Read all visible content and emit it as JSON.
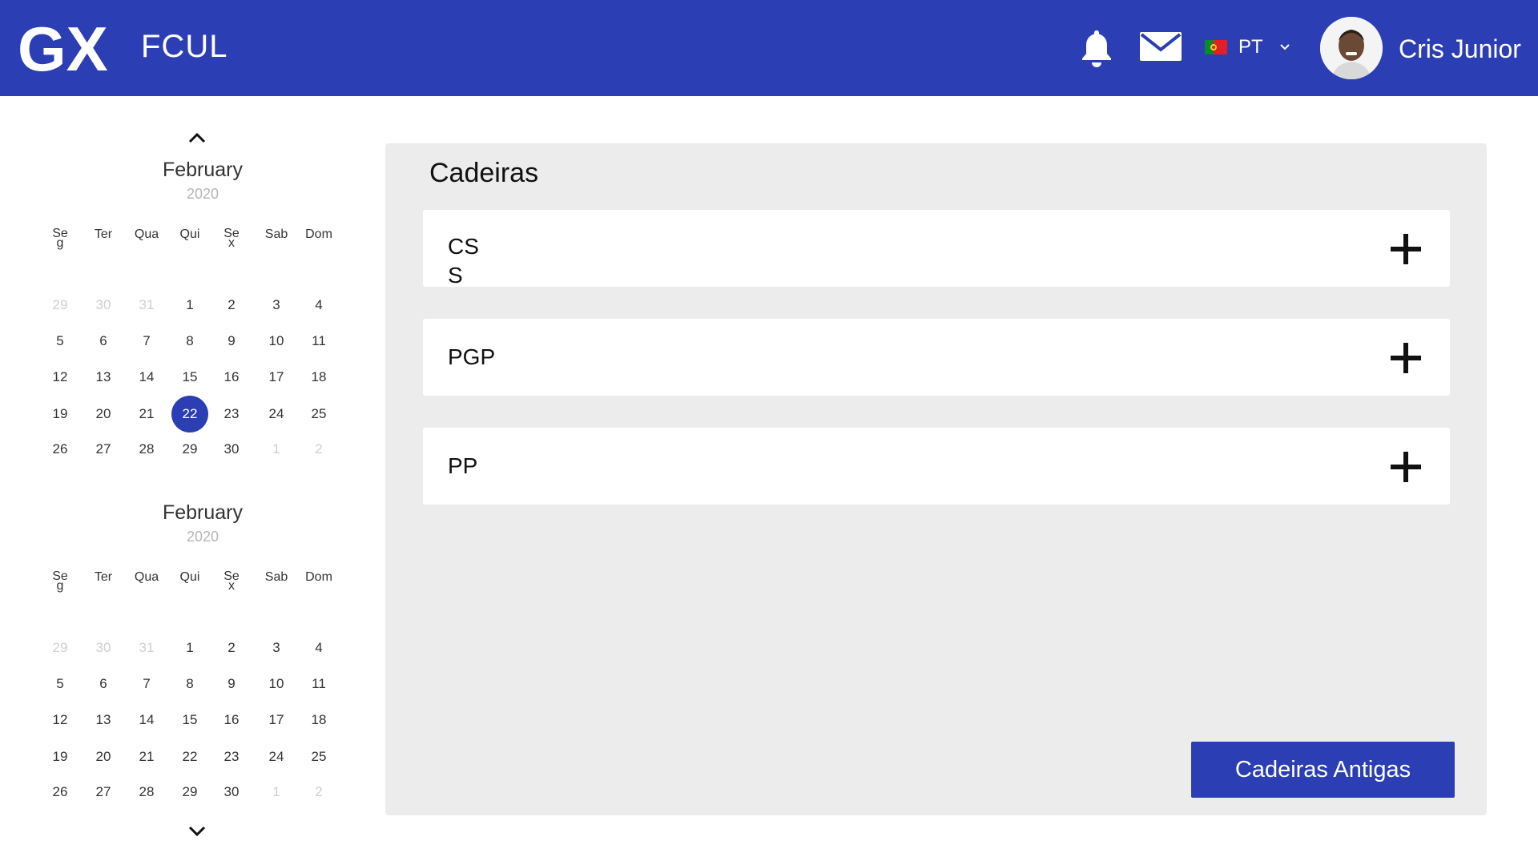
{
  "header": {
    "logo_text": "GX",
    "app_name": "FCUL",
    "language": "PT",
    "user_name": "Cris Junior",
    "brand_color": "#2c3eb3",
    "icons": [
      "bell-icon",
      "mail-icon",
      "portugal-flag-icon",
      "chevron-down-icon",
      "avatar"
    ]
  },
  "calendars": [
    {
      "month": "February",
      "year": "2020",
      "weekdays": [
        "Seg",
        "Ter",
        "Qua",
        "Qui",
        "Sex",
        "Sab",
        "Dom"
      ],
      "weeks": [
        [
          "29",
          "30",
          "31",
          "1",
          "2",
          "3",
          "4"
        ],
        [
          "5",
          "6",
          "7",
          "8",
          "9",
          "10",
          "11"
        ],
        [
          "12",
          "13",
          "14",
          "15",
          "16",
          "17",
          "18"
        ],
        [
          "19",
          "20",
          "21",
          "22",
          "23",
          "24",
          "25"
        ],
        [
          "26",
          "27",
          "28",
          "29",
          "30",
          "1",
          "2"
        ]
      ],
      "selected_day": "22"
    },
    {
      "month": "February",
      "year": "2020",
      "weekdays": [
        "Seg",
        "Ter",
        "Qua",
        "Qui",
        "Sex",
        "Sab",
        "Dom"
      ],
      "weeks": [
        [
          "29",
          "30",
          "31",
          "1",
          "2",
          "3",
          "4"
        ],
        [
          "5",
          "6",
          "7",
          "8",
          "9",
          "10",
          "11"
        ],
        [
          "12",
          "13",
          "14",
          "15",
          "16",
          "17",
          "18"
        ],
        [
          "19",
          "20",
          "21",
          "22",
          "23",
          "24",
          "25"
        ],
        [
          "26",
          "27",
          "28",
          "29",
          "30",
          "1",
          "2"
        ]
      ],
      "selected_day": ""
    }
  ],
  "panel": {
    "title": "Cadeiras",
    "courses": [
      {
        "label": "CSS"
      },
      {
        "label": "PGP"
      },
      {
        "label": "PP"
      }
    ],
    "old_courses_button": "Cadeiras Antigas"
  }
}
